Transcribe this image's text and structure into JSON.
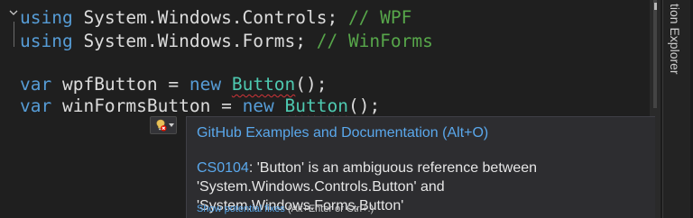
{
  "colors": {
    "background": "#1f1f1f",
    "keyword": "#569cd6",
    "type": "#4ec9b0",
    "comment": "#57a64a",
    "error_squiggle": "#d13438",
    "link": "#5aa8ec",
    "tooltip_bg": "#2d2d30"
  },
  "editor": {
    "line1": {
      "kw": "using",
      "ns": " System.Windows.Controls;",
      "comment": " // WPF"
    },
    "line2": {
      "kw": "using",
      "ns": " System.Windows.Forms;",
      "comment": " // WinForms"
    },
    "line3": {
      "kw": "var",
      "name": " wpfButton = ",
      "kw2": "new",
      "sp": " ",
      "type": "Button",
      "rest": "();"
    },
    "line4": {
      "kw": "var",
      "name": " winFormsButton = ",
      "kw2": "new",
      "sp": " ",
      "type": "Button",
      "rest": "();"
    }
  },
  "side_panel": {
    "tab_label": "tion Explorer"
  },
  "quick_actions": {
    "icon": "lightbulb-error-icon",
    "caret_icon": "caret-down-icon"
  },
  "tooltip": {
    "header": "GitHub Examples and Documentation (Alt+O)",
    "error_code": "CS0104",
    "error_message": ": 'Button' is an ambiguous reference between 'System.Windows.Controls.Button' and 'System.Windows.Forms.Button'",
    "fix_link": "Show potential fixes",
    "fix_shortcut": " (Alt+Enter or Ctrl+.)"
  }
}
